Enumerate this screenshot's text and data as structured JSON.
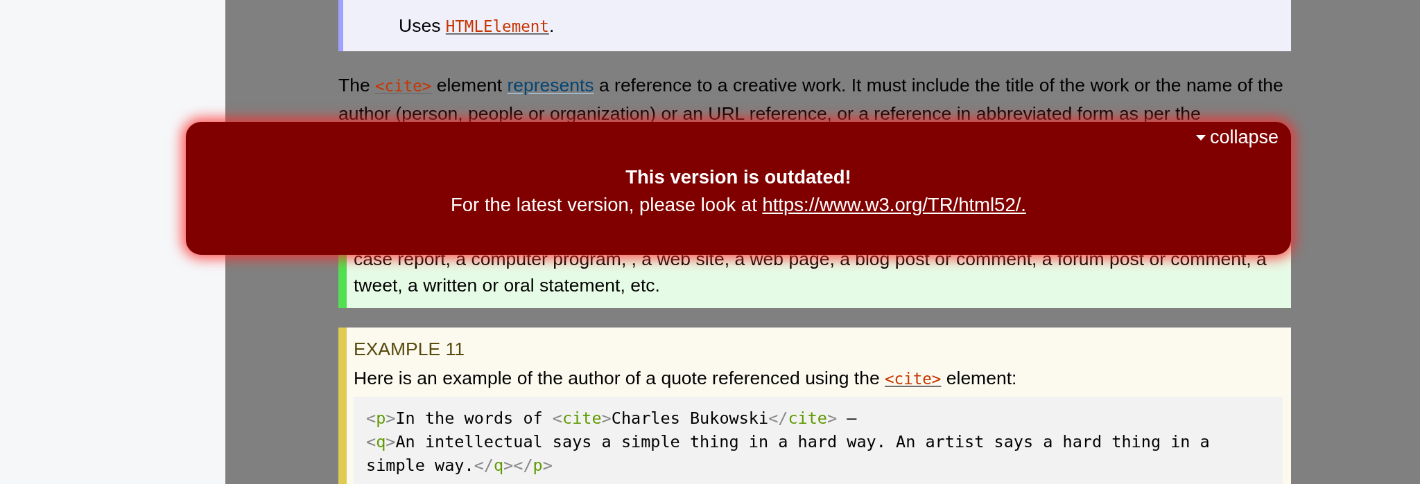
{
  "idl_note": {
    "prefix": "Uses ",
    "link": "HTMLElement",
    "suffix": "."
  },
  "intro": [
    {
      "kind": "text",
      "text": "The "
    },
    {
      "kind": "code_link",
      "text": "<cite>"
    },
    {
      "kind": "text",
      "text": " element "
    },
    {
      "kind": "link",
      "text": "represents"
    },
    {
      "kind": "text",
      "text": " a reference to a creative work. It must include the title of the work or the name of the author (person, people or organization) or an URL reference, or a reference in abbreviated form as per the"
    }
  ],
  "note_box": {
    "text": "case report, a computer program, , a web site, a web page, a blog post or comment, a forum post or comment, a tweet, a written or oral statement, etc."
  },
  "example": {
    "heading": "EXAMPLE 11",
    "intro": [
      {
        "kind": "text",
        "text": "Here is an example of the author of a quote referenced using the "
      },
      {
        "kind": "code_link",
        "text": "<cite>"
      },
      {
        "kind": "text",
        "text": " element:"
      }
    ],
    "code_lines": [
      [
        {
          "kind": "punct",
          "text": "<"
        },
        {
          "kind": "tag",
          "text": "p"
        },
        {
          "kind": "punct",
          "text": ">"
        },
        {
          "kind": "text",
          "text": "In the words of "
        },
        {
          "kind": "punct",
          "text": "<"
        },
        {
          "kind": "tag",
          "text": "cite"
        },
        {
          "kind": "punct",
          "text": ">"
        },
        {
          "kind": "text",
          "text": "Charles Bukowski"
        },
        {
          "kind": "punct",
          "text": "</"
        },
        {
          "kind": "tag",
          "text": "cite"
        },
        {
          "kind": "punct",
          "text": ">"
        },
        {
          "kind": "text",
          "text": " –"
        }
      ],
      [
        {
          "kind": "punct",
          "text": "<"
        },
        {
          "kind": "tag",
          "text": "q"
        },
        {
          "kind": "punct",
          "text": ">"
        },
        {
          "kind": "text",
          "text": "An intellectual says a simple thing in a hard way. An artist says a hard thing in a"
        }
      ],
      [
        {
          "kind": "text",
          "text": "simple way."
        },
        {
          "kind": "punct",
          "text": "</"
        },
        {
          "kind": "tag",
          "text": "q"
        },
        {
          "kind": "punct",
          "text": "></"
        },
        {
          "kind": "tag",
          "text": "p"
        },
        {
          "kind": "punct",
          "text": ">"
        }
      ]
    ]
  },
  "banner": {
    "collapse": "collapse",
    "expanded": true,
    "title": "This version is outdated!",
    "message": "For the latest version, please look at ",
    "link": "https://www.w3.org/TR/html52/."
  }
}
